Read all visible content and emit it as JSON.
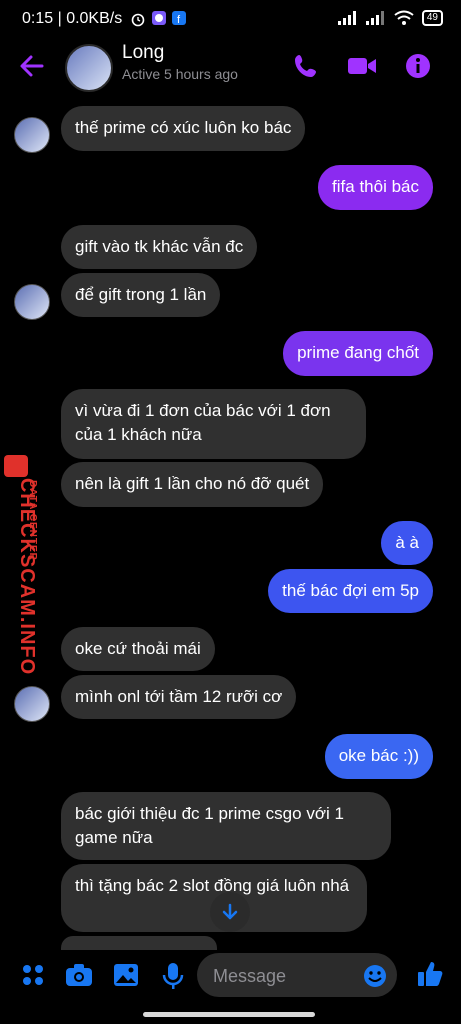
{
  "status_bar": {
    "time": "0:15",
    "speed": "0.0KB/s",
    "battery": "49"
  },
  "header": {
    "name": "Long",
    "status": "Active 5 hours ago"
  },
  "messages": [
    {
      "from": "them",
      "text": "thế prime có xúc luôn ko bác"
    },
    {
      "from": "me",
      "text": "fifa thôi bác"
    },
    {
      "from": "them",
      "text": "gift vào tk khác vẫn đc"
    },
    {
      "from": "them",
      "text": "để gift trong 1 lần"
    },
    {
      "from": "me",
      "text": "prime đang chốt"
    },
    {
      "from": "them",
      "text": "vì vừa đi 1 đơn của bác với 1 đơn của 1 khách nữa"
    },
    {
      "from": "them",
      "text": "nên là gift 1 lần cho nó đỡ quét"
    },
    {
      "from": "me",
      "text": "à à"
    },
    {
      "from": "me",
      "text": "thế bác đợi em 5p"
    },
    {
      "from": "them",
      "text": "oke cứ thoải mái"
    },
    {
      "from": "them",
      "text": "mình onl tới tầm 12 rưỡi cơ"
    },
    {
      "from": "me",
      "text": "oke bác :))"
    },
    {
      "from": "them",
      "text": "bác giới thiệu đc 1 prime csgo với 1 game nữa"
    },
    {
      "from": "them",
      "text": "thì tặng bác 2 slot đồng giá luôn nhá"
    }
  ],
  "watermark": {
    "main": "CHECKSCAM.INFO",
    "sub": "DATA CENTER"
  },
  "composer": {
    "placeholder": "Message"
  },
  "colors": {
    "accent": "#a033ff",
    "bubble_purple": "#8b2bf0",
    "bubble_blue": "#3d55f0",
    "bubble_in": "#303030",
    "icon_blue": "#1877f2"
  },
  "icons": [
    "arrow-left-icon",
    "phone-icon",
    "video-icon",
    "info-icon",
    "apps-icon",
    "camera-icon",
    "image-icon",
    "mic-icon",
    "emoji-icon",
    "like-icon",
    "arrow-down-icon"
  ]
}
